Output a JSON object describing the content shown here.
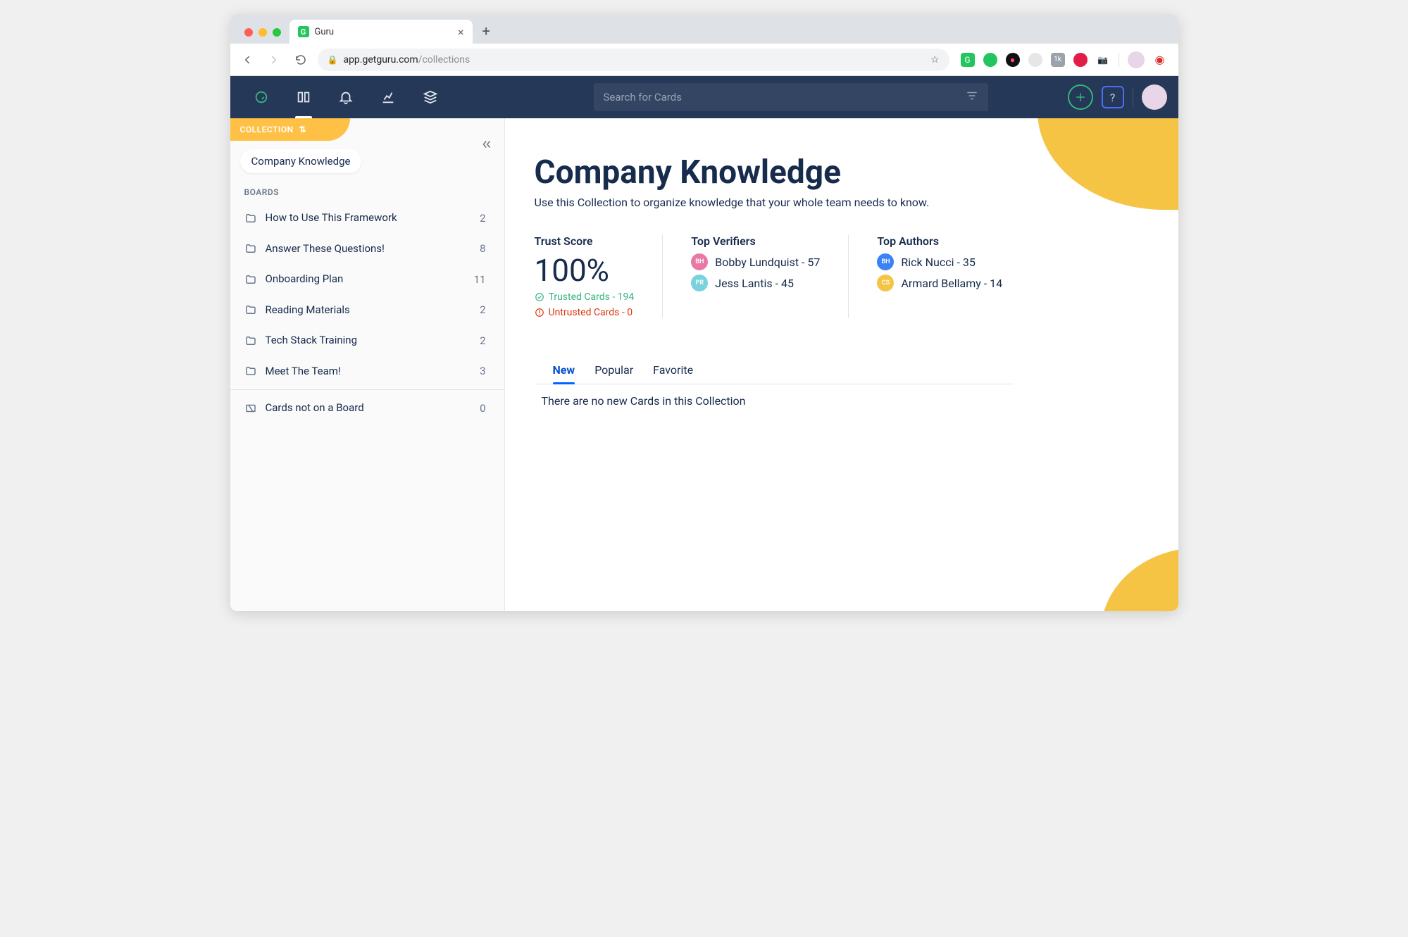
{
  "browser": {
    "tab_title": "Guru",
    "url_host": "app.getguru.com",
    "url_path": "/collections"
  },
  "header": {
    "search_placeholder": "Search for Cards"
  },
  "sidebar": {
    "collection_label": "COLLECTION",
    "collection_name": "Company Knowledge",
    "boards_label": "BOARDS",
    "boards": [
      {
        "label": "How to Use This Framework",
        "count": "2"
      },
      {
        "label": "Answer These Questions!",
        "count": "8"
      },
      {
        "label": "Onboarding Plan",
        "count": "11"
      },
      {
        "label": "Reading Materials",
        "count": "2"
      },
      {
        "label": "Tech Stack Training",
        "count": "2"
      },
      {
        "label": "Meet The Team!",
        "count": "3"
      }
    ],
    "unboarded": {
      "label": "Cards not on a Board",
      "count": "0"
    }
  },
  "main": {
    "title": "Company Knowledge",
    "subtitle": "Use this Collection to organize knowledge that your whole team needs to know.",
    "trust": {
      "heading": "Trust Score",
      "value": "100%",
      "trusted_label": "Trusted Cards - 194",
      "untrusted_label": "Untrusted Cards - 0"
    },
    "verifiers": {
      "heading": "Top Verifiers",
      "items": [
        {
          "initials": "BH",
          "text": "Bobby Lundquist - 57"
        },
        {
          "initials": "PR",
          "text": "Jess Lantis  - 45"
        }
      ]
    },
    "authors": {
      "heading": "Top Authors",
      "items": [
        {
          "initials": "BH",
          "text": "Rick Nucci - 35"
        },
        {
          "initials": "CS",
          "text": "Armard Bellamy - 14"
        }
      ]
    },
    "tabs": {
      "new": "New",
      "popular": "Popular",
      "favorite": "Favorite"
    },
    "empty": "There are no new Cards in this Collection"
  }
}
